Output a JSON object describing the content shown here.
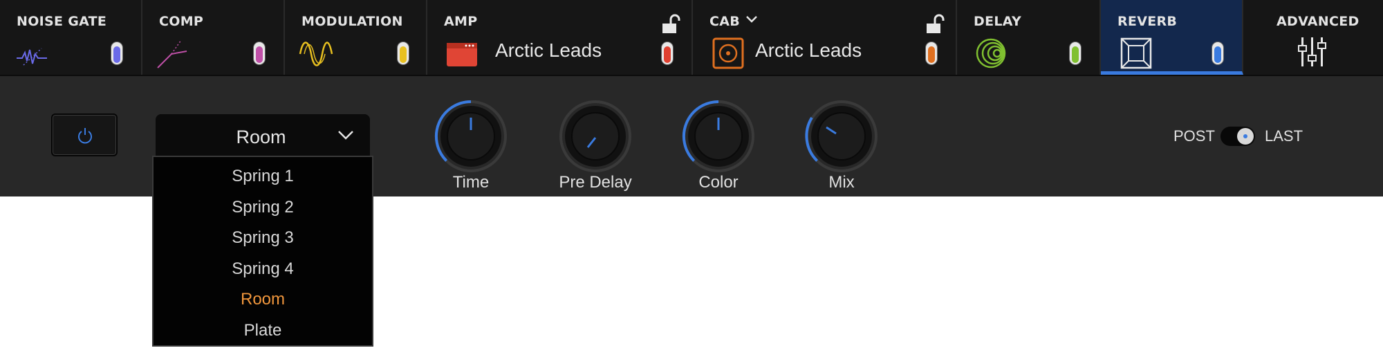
{
  "modules": {
    "noise_gate": {
      "title": "NOISE GATE",
      "toggle_color": "#6a6ae8"
    },
    "comp": {
      "title": "COMP",
      "toggle_color": "#c050a8"
    },
    "modulation": {
      "title": "MODULATION",
      "toggle_color": "#e8c020"
    },
    "amp": {
      "title": "AMP",
      "model": "Arctic Leads",
      "toggle_color": "#e04030"
    },
    "cab": {
      "title": "CAB",
      "model": "Arctic Leads",
      "toggle_color": "#e07020"
    },
    "delay": {
      "title": "DELAY",
      "toggle_color": "#80c030"
    },
    "reverb": {
      "title": "REVERB",
      "toggle_color": "#3a7be0"
    },
    "advanced": {
      "title": "ADVANCED"
    }
  },
  "reverb_panel": {
    "type_dropdown": {
      "value": "Room",
      "options": [
        "Spring 1",
        "Spring 2",
        "Spring 3",
        "Spring 4",
        "Room",
        "Plate"
      ],
      "selected": "Room"
    },
    "knobs": [
      {
        "label": "Time"
      },
      {
        "label": "Pre Delay"
      },
      {
        "label": "Color"
      },
      {
        "label": "Mix"
      }
    ],
    "position_switch": {
      "left_label": "POST",
      "right_label": "LAST",
      "value": "LAST"
    }
  },
  "colors": {
    "accent": "#3a7be0",
    "selected_item": "#f0963c"
  }
}
